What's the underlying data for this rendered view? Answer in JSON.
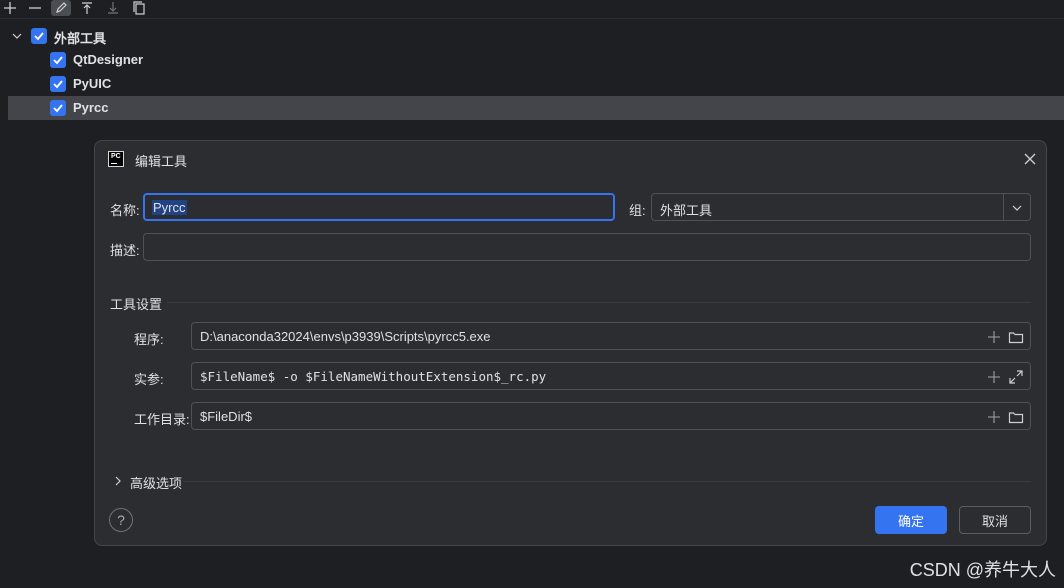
{
  "toolbar": {
    "icons": [
      "add-icon",
      "remove-icon",
      "edit-icon",
      "move-up-icon",
      "move-down-icon",
      "copy-icon"
    ]
  },
  "tree": {
    "group": {
      "label": "外部工具",
      "checked": true,
      "expanded": true
    },
    "items": [
      {
        "label": "QtDesigner",
        "checked": true
      },
      {
        "label": "PyUIC",
        "checked": true
      },
      {
        "label": "Pyrcc",
        "checked": true,
        "selected": true
      }
    ]
  },
  "dialog": {
    "title": "编辑工具",
    "name_label": "名称:",
    "name_value": "Pyrcc",
    "group_label": "组:",
    "group_value": "外部工具",
    "desc_label": "描述:",
    "desc_value": "",
    "tool_settings_label": "工具设置",
    "program_label": "程序:",
    "program_value": "D:\\anaconda32024\\envs\\p3939\\Scripts\\pyrcc5.exe",
    "args_label": "实参:",
    "args_value": "$FileName$ -o $FileNameWithoutExtension$_rc.py",
    "workdir_label": "工作目录:",
    "workdir_value": "$FileDir$",
    "advanced_label": "高级选项",
    "help_label": "?",
    "ok_label": "确定",
    "cancel_label": "取消"
  },
  "watermark": "CSDN @养牛大人",
  "colors": {
    "background": "#1e1f22",
    "dialog": "#2b2d30",
    "accent": "#3574f0",
    "text": "#dfe1e5",
    "selection_row": "#43454a"
  }
}
